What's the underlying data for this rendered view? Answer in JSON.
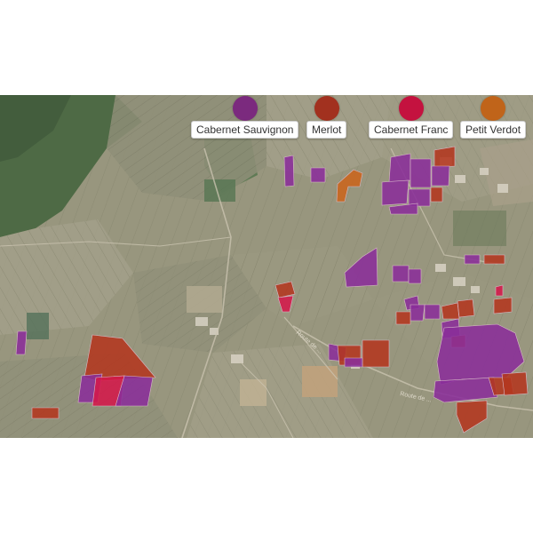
{
  "legend": [
    {
      "key": "cabernet_sauvignon",
      "label": "Cabernet Sauvignon",
      "color": "#7b2a7e"
    },
    {
      "key": "merlot",
      "label": "Merlot",
      "color": "#a2311f"
    },
    {
      "key": "cabernet_franc",
      "label": "Cabernet Franc",
      "color": "#c4123f"
    },
    {
      "key": "petit_verdot",
      "label": "Petit Verdot",
      "color": "#c0641a"
    }
  ],
  "parcel_colors": {
    "cabernet_sauvignon": "#8a2d9a",
    "merlot": "#b3371f",
    "cabernet_franc": "#d4184a",
    "petit_verdot": "#c9651c"
  },
  "road_labels": [
    "Route de ...",
    "Route de ..."
  ]
}
